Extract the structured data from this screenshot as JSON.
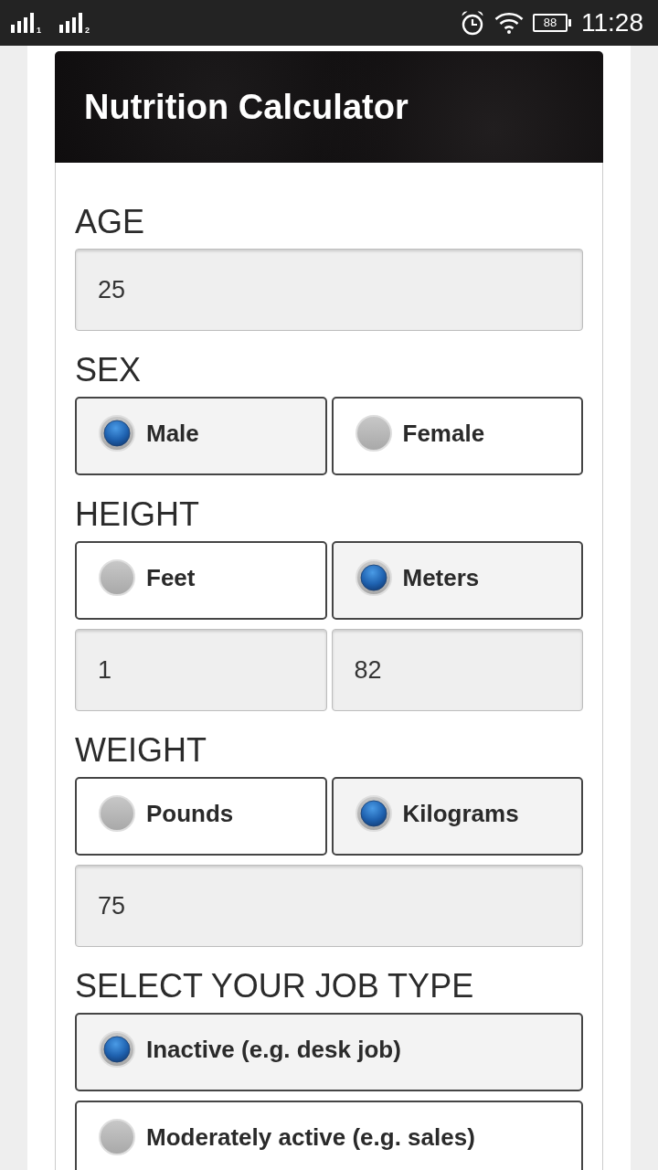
{
  "status_bar": {
    "sim_slots": [
      "1",
      "2"
    ],
    "battery": "88",
    "time": "11:28"
  },
  "header": {
    "title": "Nutrition Calculator"
  },
  "sections": [
    {
      "label": "AGE",
      "rows": [
        {
          "kind": "fields",
          "items": [
            {
              "value": "25"
            }
          ]
        }
      ]
    },
    {
      "label": "SEX",
      "rows": [
        {
          "kind": "choices",
          "items": [
            {
              "label": "Male",
              "selected": true
            },
            {
              "label": "Female",
              "selected": false
            }
          ]
        }
      ]
    },
    {
      "label": "HEIGHT",
      "rows": [
        {
          "kind": "choices",
          "items": [
            {
              "label": "Feet",
              "selected": false
            },
            {
              "label": "Meters",
              "selected": true
            }
          ]
        },
        {
          "kind": "fields",
          "items": [
            {
              "value": "1"
            },
            {
              "value": "82"
            }
          ]
        }
      ]
    },
    {
      "label": "WEIGHT",
      "rows": [
        {
          "kind": "choices",
          "items": [
            {
              "label": "Pounds",
              "selected": false
            },
            {
              "label": "Kilograms",
              "selected": true
            }
          ]
        },
        {
          "kind": "fields",
          "items": [
            {
              "value": "75"
            }
          ]
        }
      ]
    },
    {
      "label": "SELECT YOUR JOB TYPE",
      "rows": [
        {
          "kind": "choices",
          "items": [
            {
              "label": "Inactive (e.g. desk job)",
              "selected": true
            }
          ]
        },
        {
          "kind": "choices",
          "items": [
            {
              "label": "Moderately active (e.g. sales)",
              "selected": false
            }
          ]
        }
      ]
    }
  ]
}
